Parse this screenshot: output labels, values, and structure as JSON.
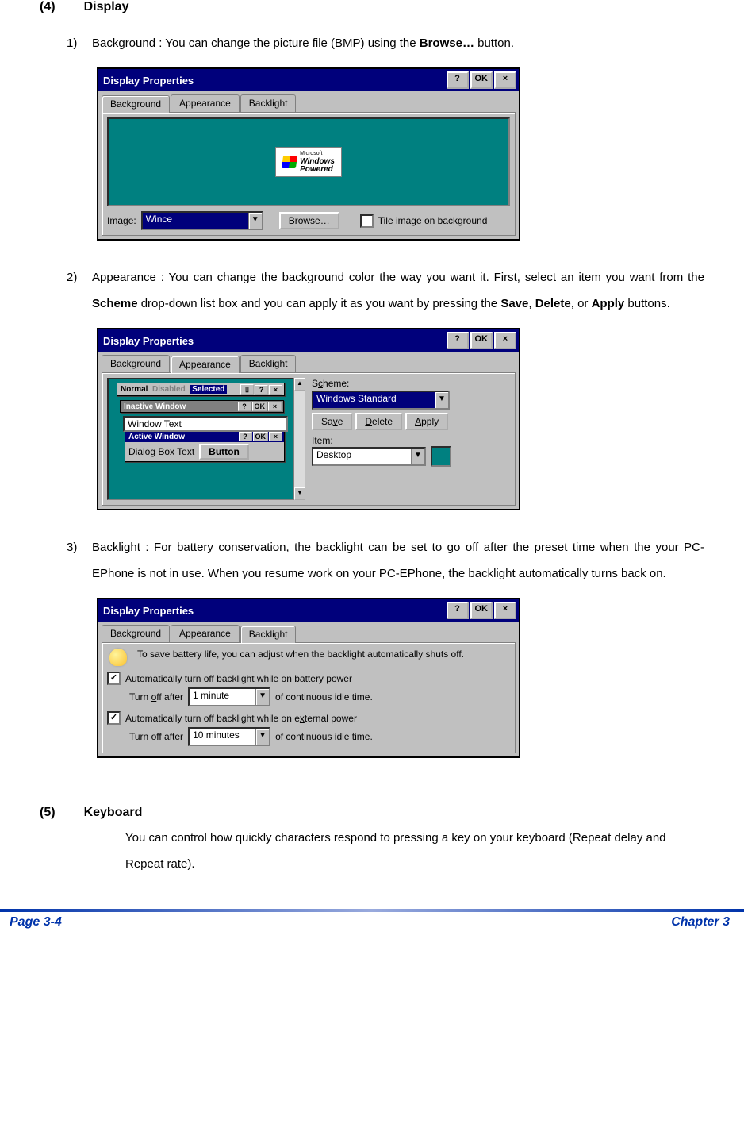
{
  "heading4": {
    "num": "(4)",
    "title": "Display"
  },
  "item1": {
    "num": "1)",
    "text_a": "Background : You can change the picture file (BMP) using the ",
    "text_bold": "Browse…",
    "text_b": " button."
  },
  "item2": {
    "num": "2)",
    "text_a": "Appearance : You can change the background color the way you want it. First, select an item you want from the ",
    "b1": "Scheme",
    "m1": " drop-down list box and you can apply it as you want by pressing the ",
    "b2": "Save",
    "m2": ", ",
    "b3": "Delete",
    "m3": ", or ",
    "b4": "Apply",
    "m4": " buttons."
  },
  "item3": {
    "num": "3)",
    "text": "Backlight : For battery conservation, the backlight can be set to go off after the preset time when the your PC-EPhone is not in use. When you resume work on your PC-EPhone, the backlight automatically turns back on."
  },
  "heading5": {
    "num": "(5)",
    "title": "Keyboard"
  },
  "kb_text": "You can control how quickly characters respond to pressing a key on your keyboard (Repeat delay and Repeat rate).",
  "dialog": {
    "title": "Display Properties",
    "help": "?",
    "ok": "OK",
    "close": "×",
    "tabs": {
      "background": "Background",
      "appearance": "Appearance",
      "backlight": "Backlight"
    }
  },
  "bg_dialog": {
    "image_label": "Image:",
    "image_value": "Wince",
    "browse": "Browse…",
    "tile": "Tile image on background",
    "logo_top": "Microsoft",
    "logo_mid": "Windows",
    "logo_bot": "Powered"
  },
  "appr_dialog": {
    "preview": {
      "normal": "Normal",
      "disabled": "Disabled",
      "selected": "Selected",
      "inactive": "Inactive Window",
      "active": "Active Window",
      "wintext": "Window Text",
      "dlgtext": "Dialog Box Text",
      "button": "Button"
    },
    "scheme_label": "Scheme:",
    "scheme_value": "Windows Standard",
    "save": "Save",
    "delete": "Delete",
    "apply": "Apply",
    "item_label": "Item:",
    "item_value": "Desktop"
  },
  "bl_dialog": {
    "hint": "To save battery life, you can adjust when the backlight automatically shuts off.",
    "c1": "Automatically turn off backlight while on battery power",
    "c2": "Automatically turn off backlight while on external power",
    "turnoff": "Turn off after",
    "idle": "of continuous idle time.",
    "v1": "1 minute",
    "v2": "10 minutes"
  },
  "footer": {
    "left": "Page 3-4",
    "right": "Chapter 3"
  }
}
